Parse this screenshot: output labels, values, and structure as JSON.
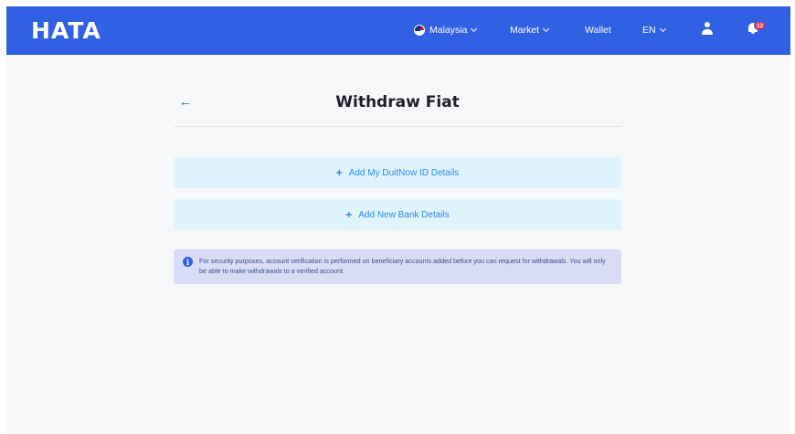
{
  "header": {
    "logo": "HATA",
    "country": "Malaysia",
    "market": "Market",
    "wallet": "Wallet",
    "language": "EN",
    "notification_count": "12",
    "colors": {
      "bar": "#3061e3",
      "badge": "#e8344e"
    }
  },
  "page": {
    "title": "Withdraw Fiat",
    "back_icon": "arrow-left-icon",
    "actions": [
      {
        "label": "Add My DuitNow ID Details",
        "icon": "plus-icon"
      },
      {
        "label": "Add New Bank Details",
        "icon": "plus-icon"
      }
    ],
    "notice": {
      "icon": "info-icon",
      "text": "For security purposes, account verification is performed on beneficiary accounts added before you can request for withdrawals. You will only be able to make withdrawals to a verified account."
    }
  }
}
